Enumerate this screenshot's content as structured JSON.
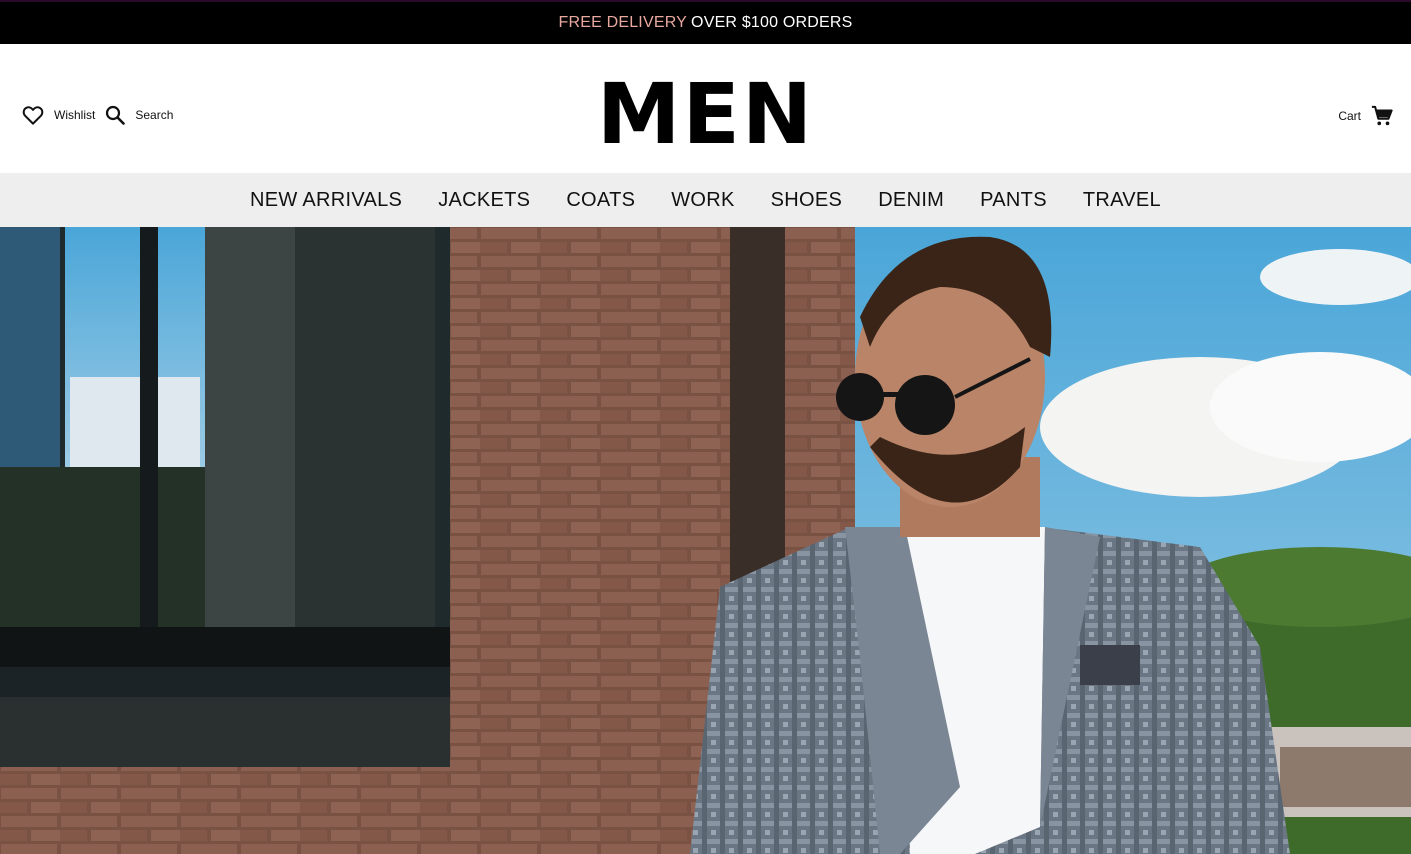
{
  "announcement": {
    "highlight": "FREE DELIVERY",
    "rest": "OVER $100 ORDERS"
  },
  "header": {
    "logo": "MEN",
    "wishlist_label": "Wishlist",
    "search_label": "Search",
    "cart_label": "Cart"
  },
  "nav": {
    "items": [
      {
        "label": "NEW ARRIVALS"
      },
      {
        "label": "JACKETS"
      },
      {
        "label": "COATS"
      },
      {
        "label": "WORK"
      },
      {
        "label": "SHOES"
      },
      {
        "label": "DENIM"
      },
      {
        "label": "PANTS"
      },
      {
        "label": "TRAVEL"
      }
    ]
  },
  "hero": {
    "image": "man-in-grey-blazer-sunglasses-photo"
  },
  "colors": {
    "accent": "#e8a8a0",
    "topbar": "#000000",
    "nav_bg": "#eeeeee"
  }
}
